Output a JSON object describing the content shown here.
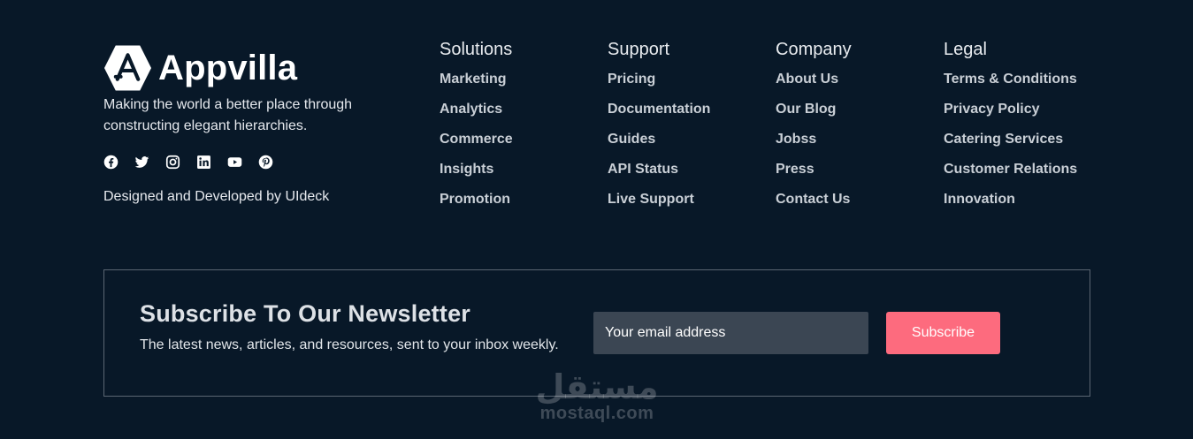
{
  "brand": {
    "name": "Appvilla",
    "tagline": "Making the world a better place through constructing elegant hierarchies.",
    "credit": "Designed and Developed by UIdeck",
    "socials": [
      "facebook-icon",
      "twitter-icon",
      "instagram-icon",
      "linkedin-icon",
      "youtube-icon",
      "pinterest-icon"
    ]
  },
  "columns": [
    {
      "title": "Solutions",
      "links": [
        "Marketing",
        "Analytics",
        "Commerce",
        "Insights",
        "Promotion"
      ]
    },
    {
      "title": "Support",
      "links": [
        "Pricing",
        "Documentation",
        "Guides",
        "API Status",
        "Live Support"
      ]
    },
    {
      "title": "Company",
      "links": [
        "About Us",
        "Our Blog",
        "Jobss",
        "Press",
        "Contact Us"
      ]
    },
    {
      "title": "Legal",
      "links": [
        "Terms & Conditions",
        "Privacy Policy",
        "Catering Services",
        "Customer Relations",
        "Innovation"
      ]
    }
  ],
  "newsletter": {
    "title": "Subscribe To Our Newsletter",
    "subtitle": "The latest news, articles, and resources, sent to your inbox weekly.",
    "email_placeholder": "Your email address",
    "button_label": "Subscribe"
  },
  "watermark": {
    "arabic": "مستقل",
    "latin": "mostaql.com"
  },
  "colors": {
    "background": "#081828",
    "accent": "#fd6b7e",
    "input_bg": "#3b4653"
  }
}
